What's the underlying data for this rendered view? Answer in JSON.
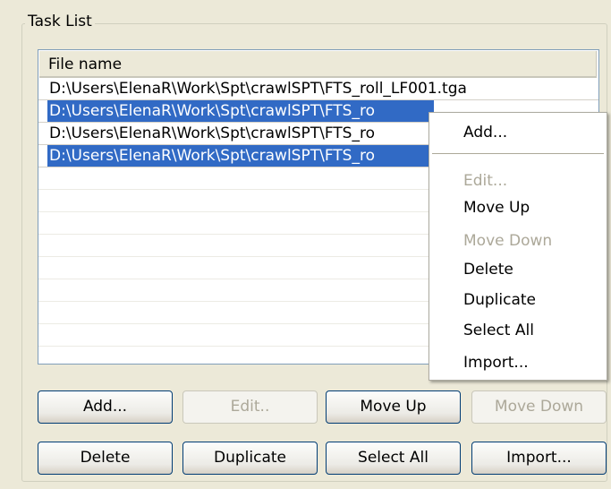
{
  "groupbox": {
    "title": "Task List"
  },
  "list": {
    "header": "File name",
    "rows": [
      {
        "text": "D:\\Users\\ElenaR\\Work\\Spt\\crawlSPT\\FTS_roll_LF001.tga",
        "selected": false
      },
      {
        "text": "D:\\Users\\ElenaR\\Work\\Spt\\crawlSPT\\FTS_ro",
        "selected": true
      },
      {
        "text": "D:\\Users\\ElenaR\\Work\\Spt\\crawlSPT\\FTS_ro",
        "selected": false
      },
      {
        "text": "D:\\Users\\ElenaR\\Work\\Spt\\crawlSPT\\FTS_ro",
        "selected": true
      }
    ]
  },
  "buttons": {
    "add": "Add...",
    "edit": "Edit..",
    "move_up": "Move Up",
    "move_down": "Move Down",
    "delete": "Delete",
    "duplicate": "Duplicate",
    "select_all": "Select All",
    "import": "Import..."
  },
  "context_menu": {
    "add": "Add...",
    "edit": "Edit...",
    "move_up": "Move Up",
    "move_down": "Move Down",
    "delete": "Delete",
    "duplicate": "Duplicate",
    "select_all": "Select All",
    "import": "Import..."
  },
  "colors": {
    "selection": "#316ac5",
    "window_bg": "#ece9d8",
    "disabled_text": "#aca899"
  }
}
